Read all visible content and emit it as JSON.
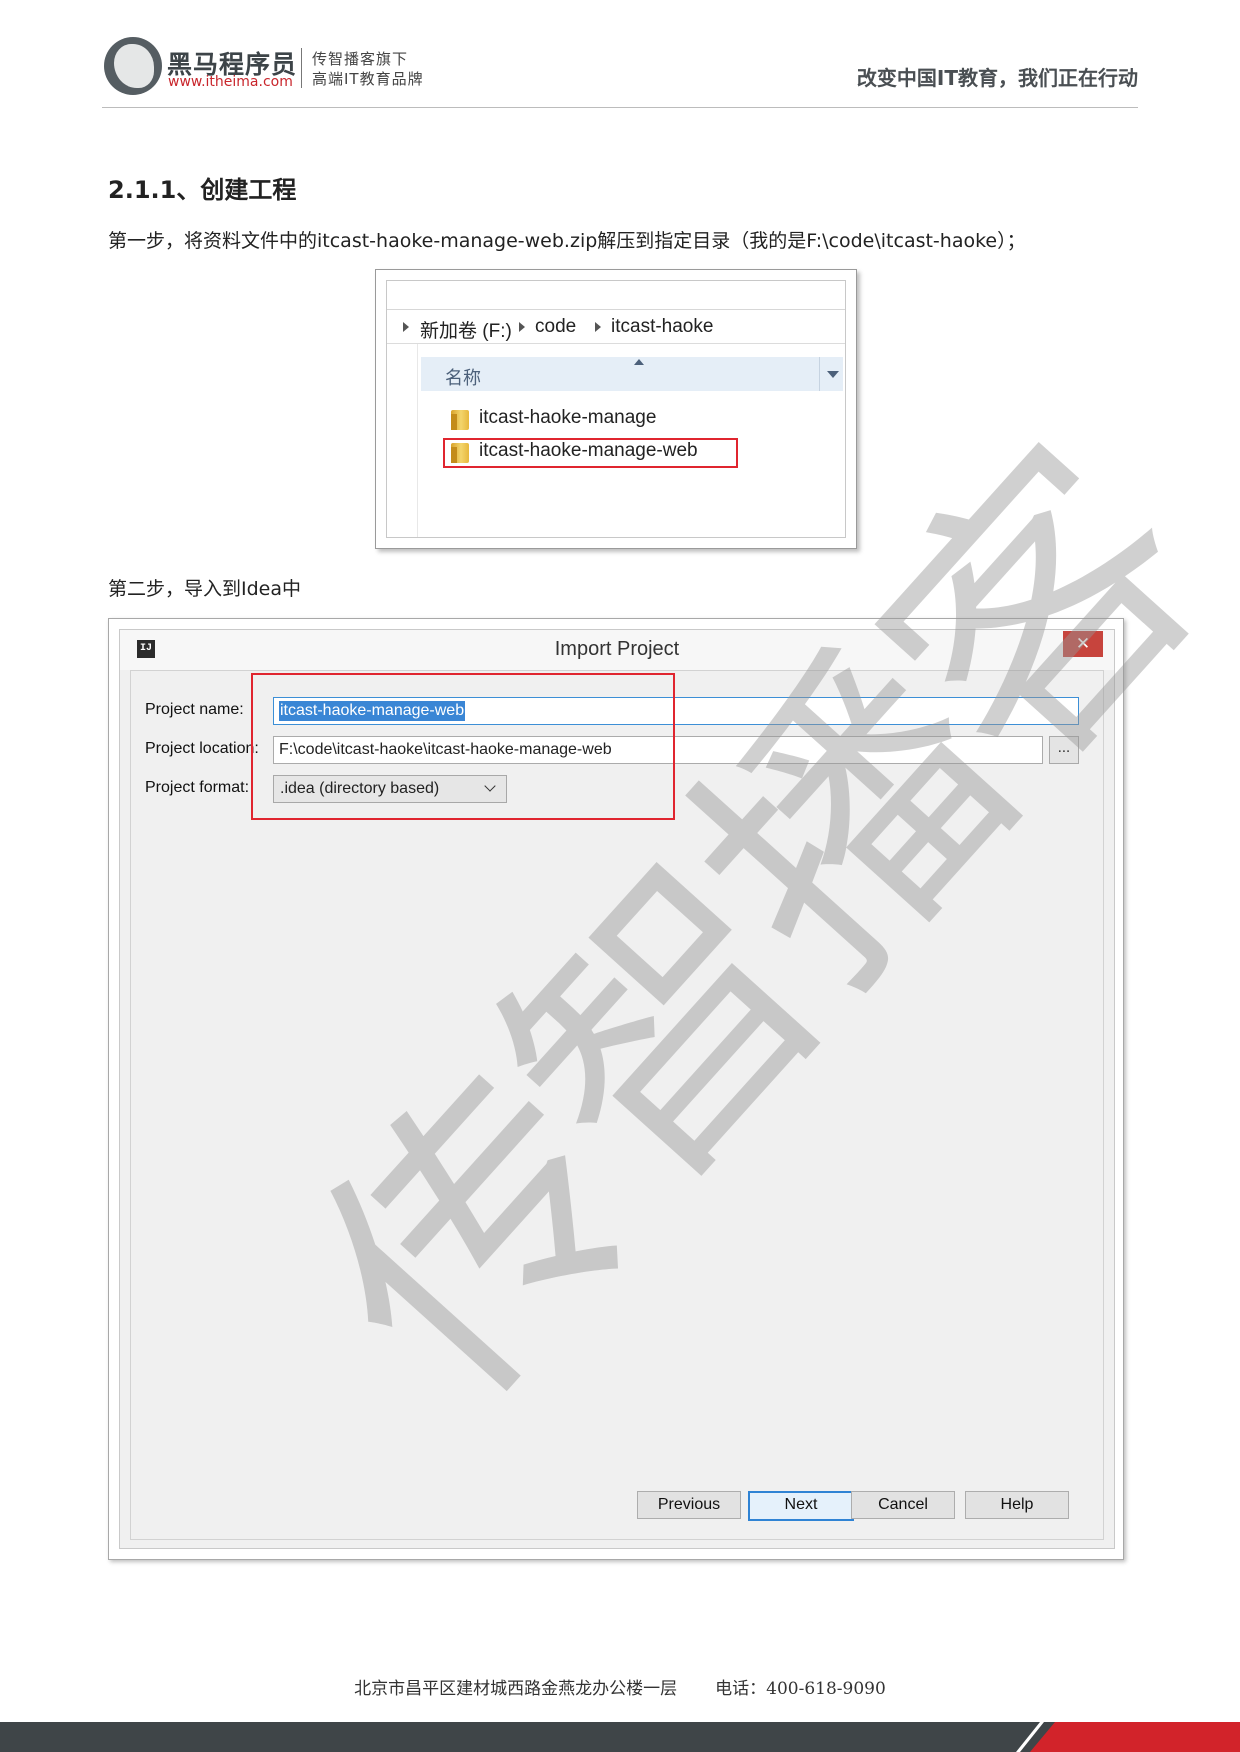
{
  "header": {
    "brand_name": "黑马程序员",
    "brand_url": "www.itheima.com",
    "tagline_1": "传智播客旗下",
    "tagline_2": "高端IT教育品牌",
    "slogan": "改变中国IT教育，我们正在行动"
  },
  "section_heading": "2.1.1、创建工程",
  "step1_text": "第一步，将资料文件中的itcast-haoke-manage-web.zip解压到指定目录（我的是F:\\code\\itcast-haoke）；",
  "step2_text": "第二步，导入到Idea中",
  "explorer": {
    "breadcrumbs": [
      "新加卷 (F:)",
      "code",
      "itcast-haoke"
    ],
    "column_header": "名称",
    "items": [
      "itcast-haoke-manage",
      "itcast-haoke-manage-web"
    ],
    "highlighted_item": "itcast-haoke-manage-web"
  },
  "dialog": {
    "icon_label": "IJ",
    "title": "Import Project",
    "close_glyph": "✕",
    "labels": {
      "project_name": "Project name:",
      "project_location": "Project location:",
      "project_format": "Project format:"
    },
    "values": {
      "project_name": "itcast-haoke-manage-web",
      "project_location": "F:\\code\\itcast-haoke\\itcast-haoke-manage-web",
      "project_format": ".idea (directory based)"
    },
    "browse_label": "...",
    "buttons": {
      "previous": "Previous",
      "next": "Next",
      "cancel": "Cancel",
      "help": "Help"
    }
  },
  "watermark": "传智播客",
  "footer": {
    "address": "北京市昌平区建材城西路金燕龙办公楼一层",
    "phone": "电话：400-618-9090"
  },
  "colors": {
    "highlight_red": "#e0252f",
    "selection_blue": "#3a86d5",
    "footer_dark": "#3f4548",
    "footer_red": "#d2232a"
  }
}
